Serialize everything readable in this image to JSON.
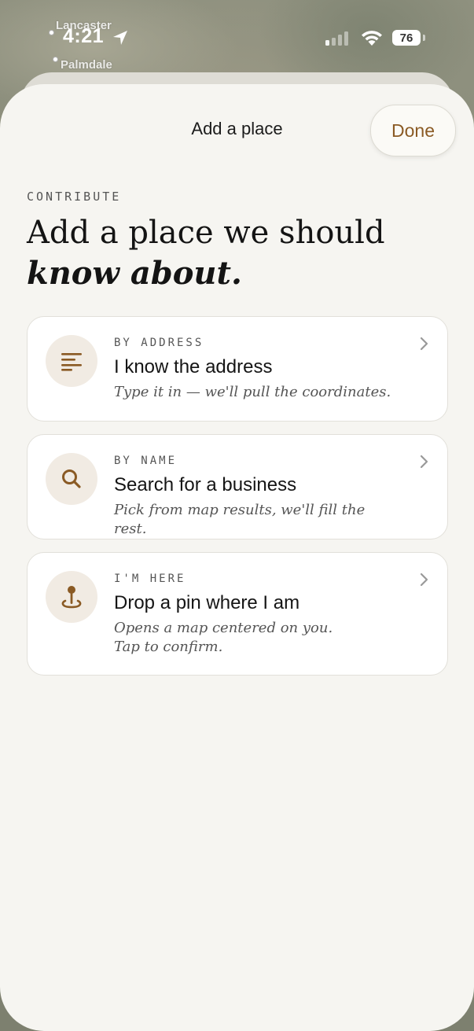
{
  "map": {
    "labels": [
      "Lancaster",
      "Palmdale"
    ]
  },
  "status_bar": {
    "time": "4:21",
    "battery": "76"
  },
  "sheet": {
    "title": "Add a place",
    "done_label": "Done"
  },
  "intro": {
    "eyebrow": "CONTRIBUTE",
    "headline_line1": "Add a place we should",
    "headline_line2": "know about."
  },
  "options": [
    {
      "eyebrow": "BY ADDRESS",
      "title": "I know the address",
      "subtitle": "Type it in — we'll pull the coordinates.",
      "icon": "address-lines-icon"
    },
    {
      "eyebrow": "BY NAME",
      "title": "Search for a business",
      "subtitle": "Pick from map results, we'll fill the rest.",
      "icon": "search-icon"
    },
    {
      "eyebrow": "I'M HERE",
      "title": "Drop a pin where I am",
      "subtitle": "Opens a map centered on you. Tap to confirm.",
      "icon": "map-pin-icon"
    }
  ],
  "colors": {
    "accent": "#8a5a24",
    "icon_bg": "#f1ebe3",
    "sheet_bg": "#f6f5f1"
  }
}
